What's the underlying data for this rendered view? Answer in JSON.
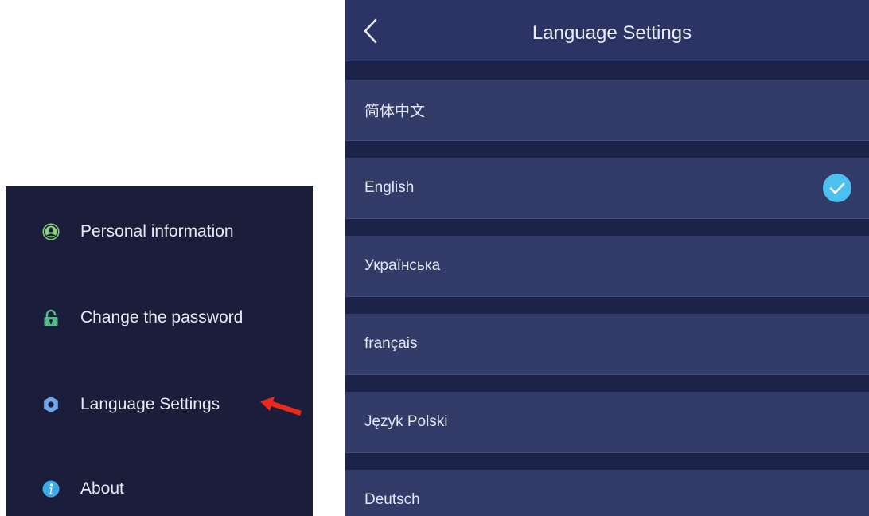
{
  "left_menu": {
    "items": [
      {
        "label": "Personal information",
        "icon": "user-circle-icon",
        "icon_color": "#8bd37a"
      },
      {
        "label": "Change the password",
        "icon": "lock-icon",
        "icon_color": "#58b98a"
      },
      {
        "label": "Language Settings",
        "icon": "gear-icon",
        "icon_color": "#6fa8e8"
      },
      {
        "label": "About",
        "icon": "info-icon",
        "icon_color": "#3fa9e6"
      }
    ],
    "annotation": {
      "icon": "red-arrow-icon",
      "color": "#e8291c"
    }
  },
  "language_screen": {
    "title": "Language Settings",
    "back_icon": "chevron-left-icon",
    "languages": [
      {
        "label": "简体中文",
        "selected": false
      },
      {
        "label": "English",
        "selected": true
      },
      {
        "label": "Українська",
        "selected": false
      },
      {
        "label": "français",
        "selected": false
      },
      {
        "label": "Język Polski",
        "selected": false
      },
      {
        "label": "Deutsch",
        "selected": false
      }
    ],
    "check_icon": "check-circle-icon",
    "colors": {
      "background": "#1d2249",
      "header": "#2c3466",
      "row": "#333c69",
      "check": "#4cc1f0"
    }
  }
}
